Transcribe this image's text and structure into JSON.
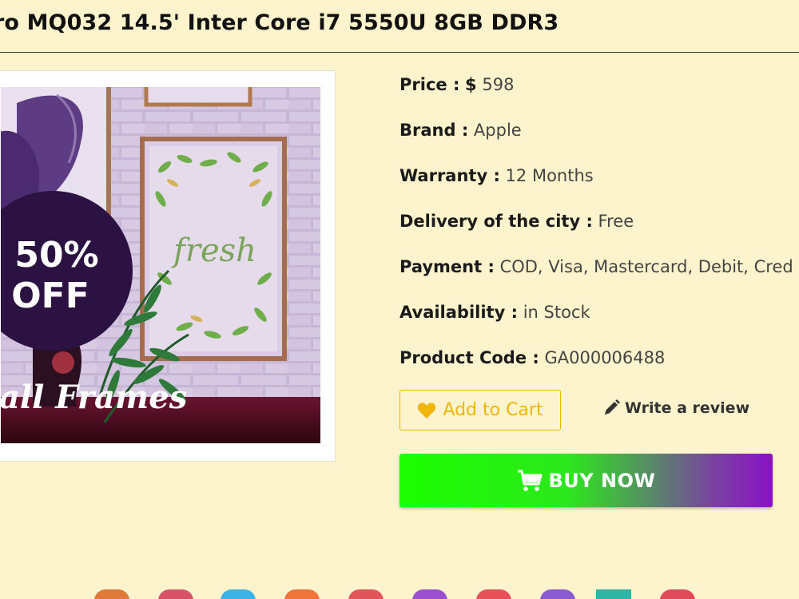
{
  "product": {
    "title": "ro MQ032 14.5' Inter Core i7 5550U 8GB DDR3"
  },
  "banner": {
    "promo_line1": "50%",
    "promo_line2": "OFF",
    "script_word": "fresh",
    "caption": "all Frames"
  },
  "details": [
    {
      "label": "Price :",
      "value": "598",
      "prefix": "$"
    },
    {
      "label": "Brand :",
      "value": "Apple"
    },
    {
      "label": "Warranty :",
      "value": "12 Months"
    },
    {
      "label": "Delivery of the city :",
      "value": "Free"
    },
    {
      "label": "Payment :",
      "value": "COD, Visa, Mastercard, Debit, Cred"
    },
    {
      "label": "Availability :",
      "value": "in Stock"
    },
    {
      "label": "Product Code :",
      "value": "GA000006488"
    }
  ],
  "actions": {
    "add_to_cart": "Add to Cart",
    "write_review": "Write a review",
    "buy_now": "BUY NOW"
  },
  "icons": {
    "add_to_cart": "heart-icon",
    "write_review": "pencil-icon",
    "buy_now": "shopping-cart-icon"
  },
  "colors": {
    "background": "#fdf3cc",
    "accent": "#f2b50c",
    "buy_gradient_start": "#1cff00",
    "buy_gradient_end": "#8b12c7"
  }
}
